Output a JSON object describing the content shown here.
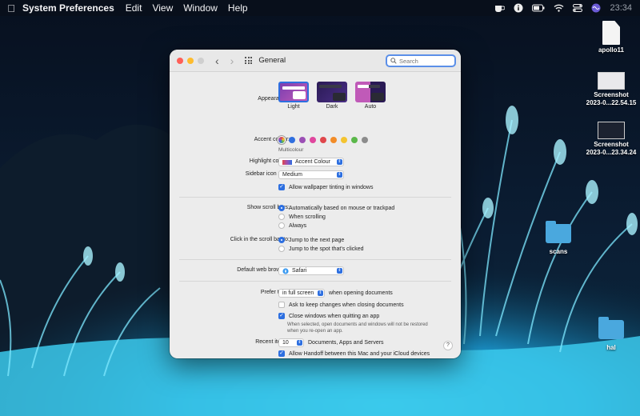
{
  "menubar": {
    "app_name": "System Preferences",
    "menus": [
      "Edit",
      "View",
      "Window",
      "Help"
    ],
    "clock": "23:34"
  },
  "desktop": {
    "items": [
      {
        "label": "apollo11",
        "kind": "document"
      },
      {
        "label": "Screenshot 2023-0...22.54.15",
        "kind": "screenshot"
      },
      {
        "label": "Screenshot 2023-0...23.34.24",
        "kind": "screenshot"
      },
      {
        "label": "scans",
        "kind": "folder"
      },
      {
        "label": "hal",
        "kind": "folder"
      }
    ]
  },
  "window": {
    "title": "General",
    "search_placeholder": "Search",
    "appearance": {
      "label": "Appearance:",
      "options": [
        "Light",
        "Dark",
        "Auto"
      ],
      "selected": "Light"
    },
    "accent": {
      "label": "Accent colour:",
      "caption": "Multicolour",
      "colors": [
        "#8e44ad",
        "#2f6fdf",
        "#9b4fb5",
        "#e0479e",
        "#e0474c",
        "#f28c28",
        "#f4c430",
        "#5bb84a",
        "#8c8c8c"
      ]
    },
    "highlight": {
      "label": "Highlight colour:",
      "value": "Accent Colour"
    },
    "sidebar_icon_size": {
      "label": "Sidebar icon size:",
      "value": "Medium"
    },
    "wallpaper_tinting": {
      "label": "Allow wallpaper tinting in windows",
      "checked": true
    },
    "scroll_bars": {
      "label": "Show scroll bars:",
      "options": [
        "Automatically based on mouse or trackpad",
        "When scrolling",
        "Always"
      ],
      "selected": 0
    },
    "click_scroll_bar": {
      "label": "Click in the scroll bar to:",
      "options": [
        "Jump to the next page",
        "Jump to the spot that's clicked"
      ],
      "selected": 0
    },
    "default_browser": {
      "label": "Default web browser:",
      "value": "Safari"
    },
    "prefer_tabs": {
      "label": "Prefer tabs:",
      "value": "in full screen",
      "suffix": "when opening documents"
    },
    "ask_keep_changes": {
      "label": "Ask to keep changes when closing documents",
      "checked": false
    },
    "close_windows": {
      "label": "Close windows when quitting an app",
      "checked": true,
      "note_line1": "When selected, open documents and windows will not be restored",
      "note_line2": "when you re-open an app."
    },
    "recent_items": {
      "label": "Recent items:",
      "value": "10",
      "suffix": "Documents, Apps and Servers"
    },
    "handoff": {
      "label": "Allow Handoff between this Mac and your iCloud devices",
      "checked": true
    },
    "help": "?"
  },
  "colors": {
    "accent": "#2d6fe0",
    "window_bg": "#ececec"
  }
}
